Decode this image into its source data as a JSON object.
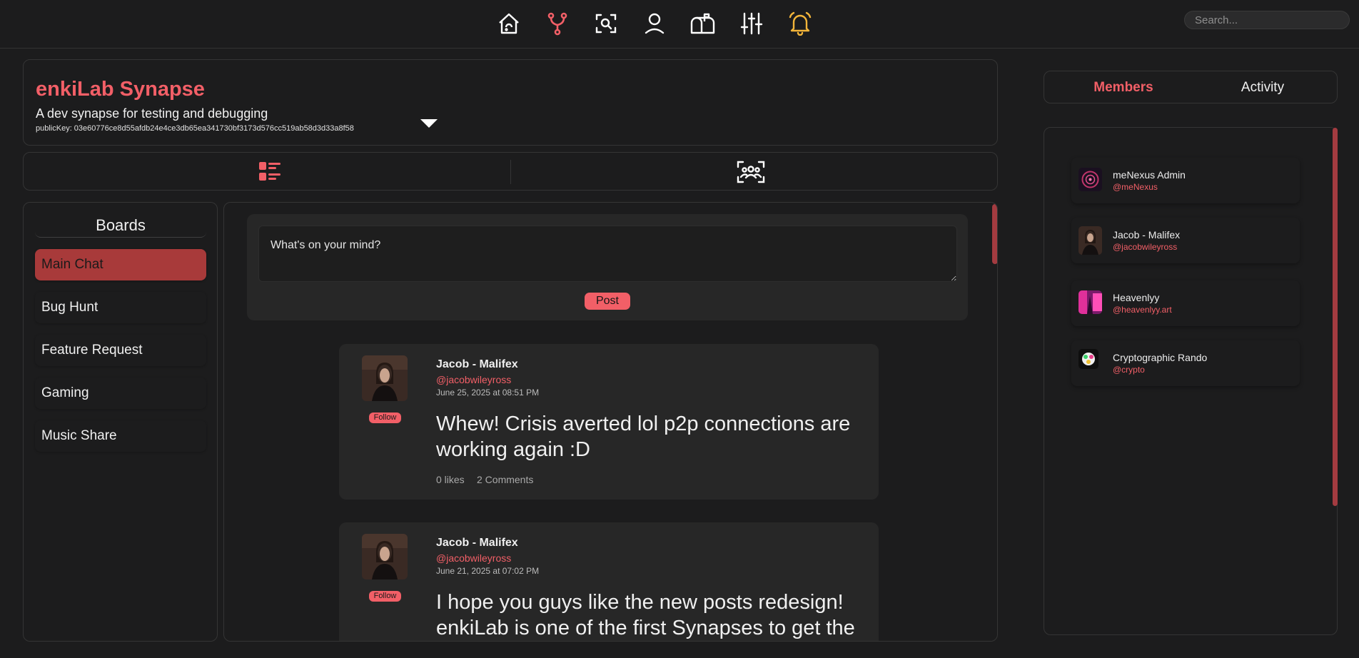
{
  "search": {
    "placeholder": "Search..."
  },
  "nav": {
    "icons": [
      "home-icon",
      "synapse-fork-icon",
      "search-scan-icon",
      "profile-icon",
      "mailbox-icon",
      "settings-sliders-icon",
      "notifications-bell-icon"
    ],
    "active_color": "#f25f67",
    "bell_color": "#f3b53a"
  },
  "synapse": {
    "title": "enkiLab Synapse",
    "description": "A dev synapse for testing and debugging",
    "public_key_label": "publicKey: 03e60776ce8d55afdb24e4ce3db65ea341730bf3173d576cc519ab58d3d33a8f58"
  },
  "boards": {
    "title": "Boards",
    "items": [
      {
        "label": "Main Chat",
        "active": true
      },
      {
        "label": "Bug Hunt"
      },
      {
        "label": "Feature Request"
      },
      {
        "label": "Gaming"
      },
      {
        "label": "Music Share"
      }
    ]
  },
  "composer": {
    "placeholder": "What's on your mind?",
    "post_label": "Post"
  },
  "posts": [
    {
      "author": "Jacob - Malifex",
      "handle": "@jacobwileyross",
      "timestamp": "June 25, 2025 at 08:51 PM",
      "follow_label": "Follow",
      "body": "Whew! Crisis averted lol p2p connections are working again :D",
      "likes": "0 likes",
      "comments": "2 Comments"
    },
    {
      "author": "Jacob - Malifex",
      "handle": "@jacobwileyross",
      "timestamp": "June 21, 2025 at 07:02 PM",
      "follow_label": "Follow",
      "body": "I hope you guys like the new posts redesign! enkiLab is one of the first Synapses to get the"
    }
  ],
  "right_tabs": {
    "members": "Members",
    "activity": "Activity",
    "active": "members"
  },
  "members": [
    {
      "name": "meNexus Admin",
      "handle": "@meNexus"
    },
    {
      "name": "Jacob - Malifex",
      "handle": "@jacobwileyross"
    },
    {
      "name": "Heavenlyy",
      "handle": "@heavenlyy.art"
    },
    {
      "name": "Cryptographic Rando",
      "handle": "@crypto"
    }
  ],
  "colors": {
    "accent": "#f25f67",
    "background": "#1c1c1d",
    "card": "#272727"
  }
}
